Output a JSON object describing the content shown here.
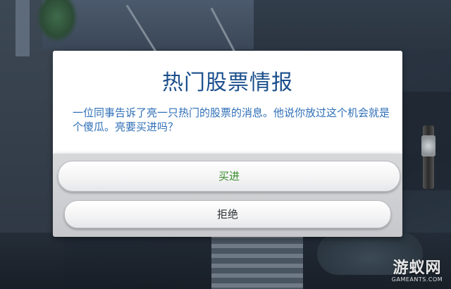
{
  "dialog": {
    "title": "热门股票情报",
    "body": "一位同事告诉了亮一只热门的股票的消息。他说你放过这个机会就是个傻瓜。亮要买进吗？",
    "buy_label": "买进",
    "refuse_label": "拒绝"
  },
  "watermark": {
    "text": "游蚁网",
    "url": "GAMEANTS.COM"
  },
  "colors": {
    "title": "#1b4f8c",
    "body": "#2f6fb6",
    "buy": "#3a8d2c",
    "refuse": "#2b2f33"
  }
}
